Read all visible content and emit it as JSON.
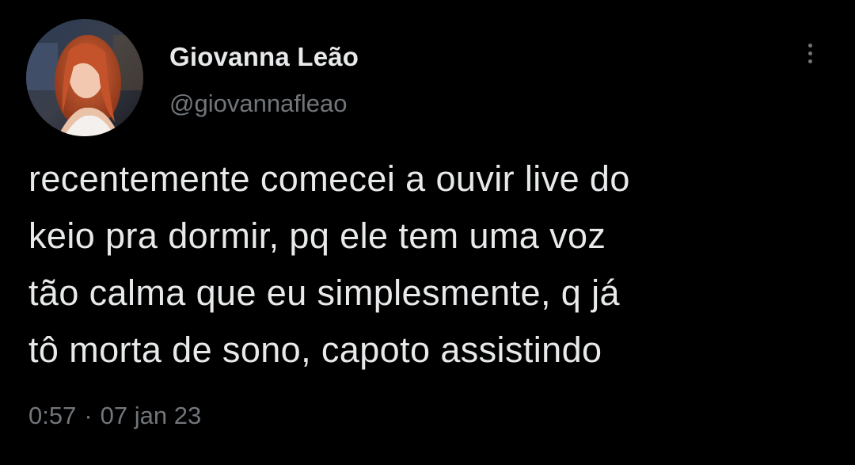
{
  "author": {
    "display_name": "Giovanna Leão",
    "handle": "@giovannafleao"
  },
  "tweet": {
    "text_lines": [
      "recentemente comecei a ouvir live do",
      "keio pra dormir, pq ele tem uma voz",
      "tão calma que eu simplesmente, q já",
      "tô morta de sono, capoto assistindo"
    ],
    "time": "0:57",
    "separator": "·",
    "date": "07 jan 23"
  },
  "icons": {
    "more": "more-vertical-icon"
  },
  "colors": {
    "background": "#000000",
    "primary_text": "#e7e9ea",
    "secondary_text": "#71767b"
  }
}
